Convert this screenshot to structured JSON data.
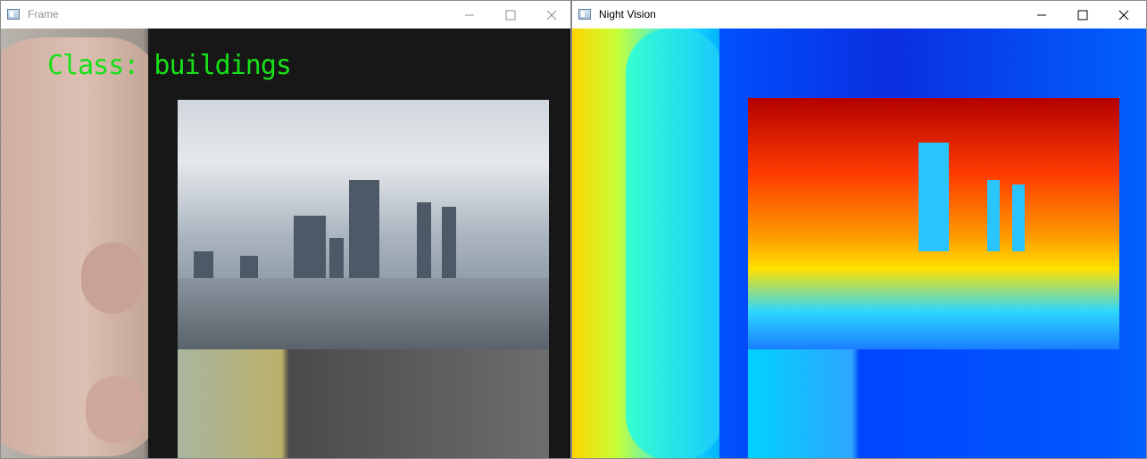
{
  "windows": {
    "frame": {
      "title": "Frame",
      "overlay_label": "Class: buildings",
      "overlay_color": "#18e018"
    },
    "night": {
      "title": "Night Vision"
    }
  },
  "icons": {
    "app": "window-app-icon",
    "minimize": "minimize-icon",
    "maximize": "maximize-icon",
    "close": "close-icon"
  }
}
